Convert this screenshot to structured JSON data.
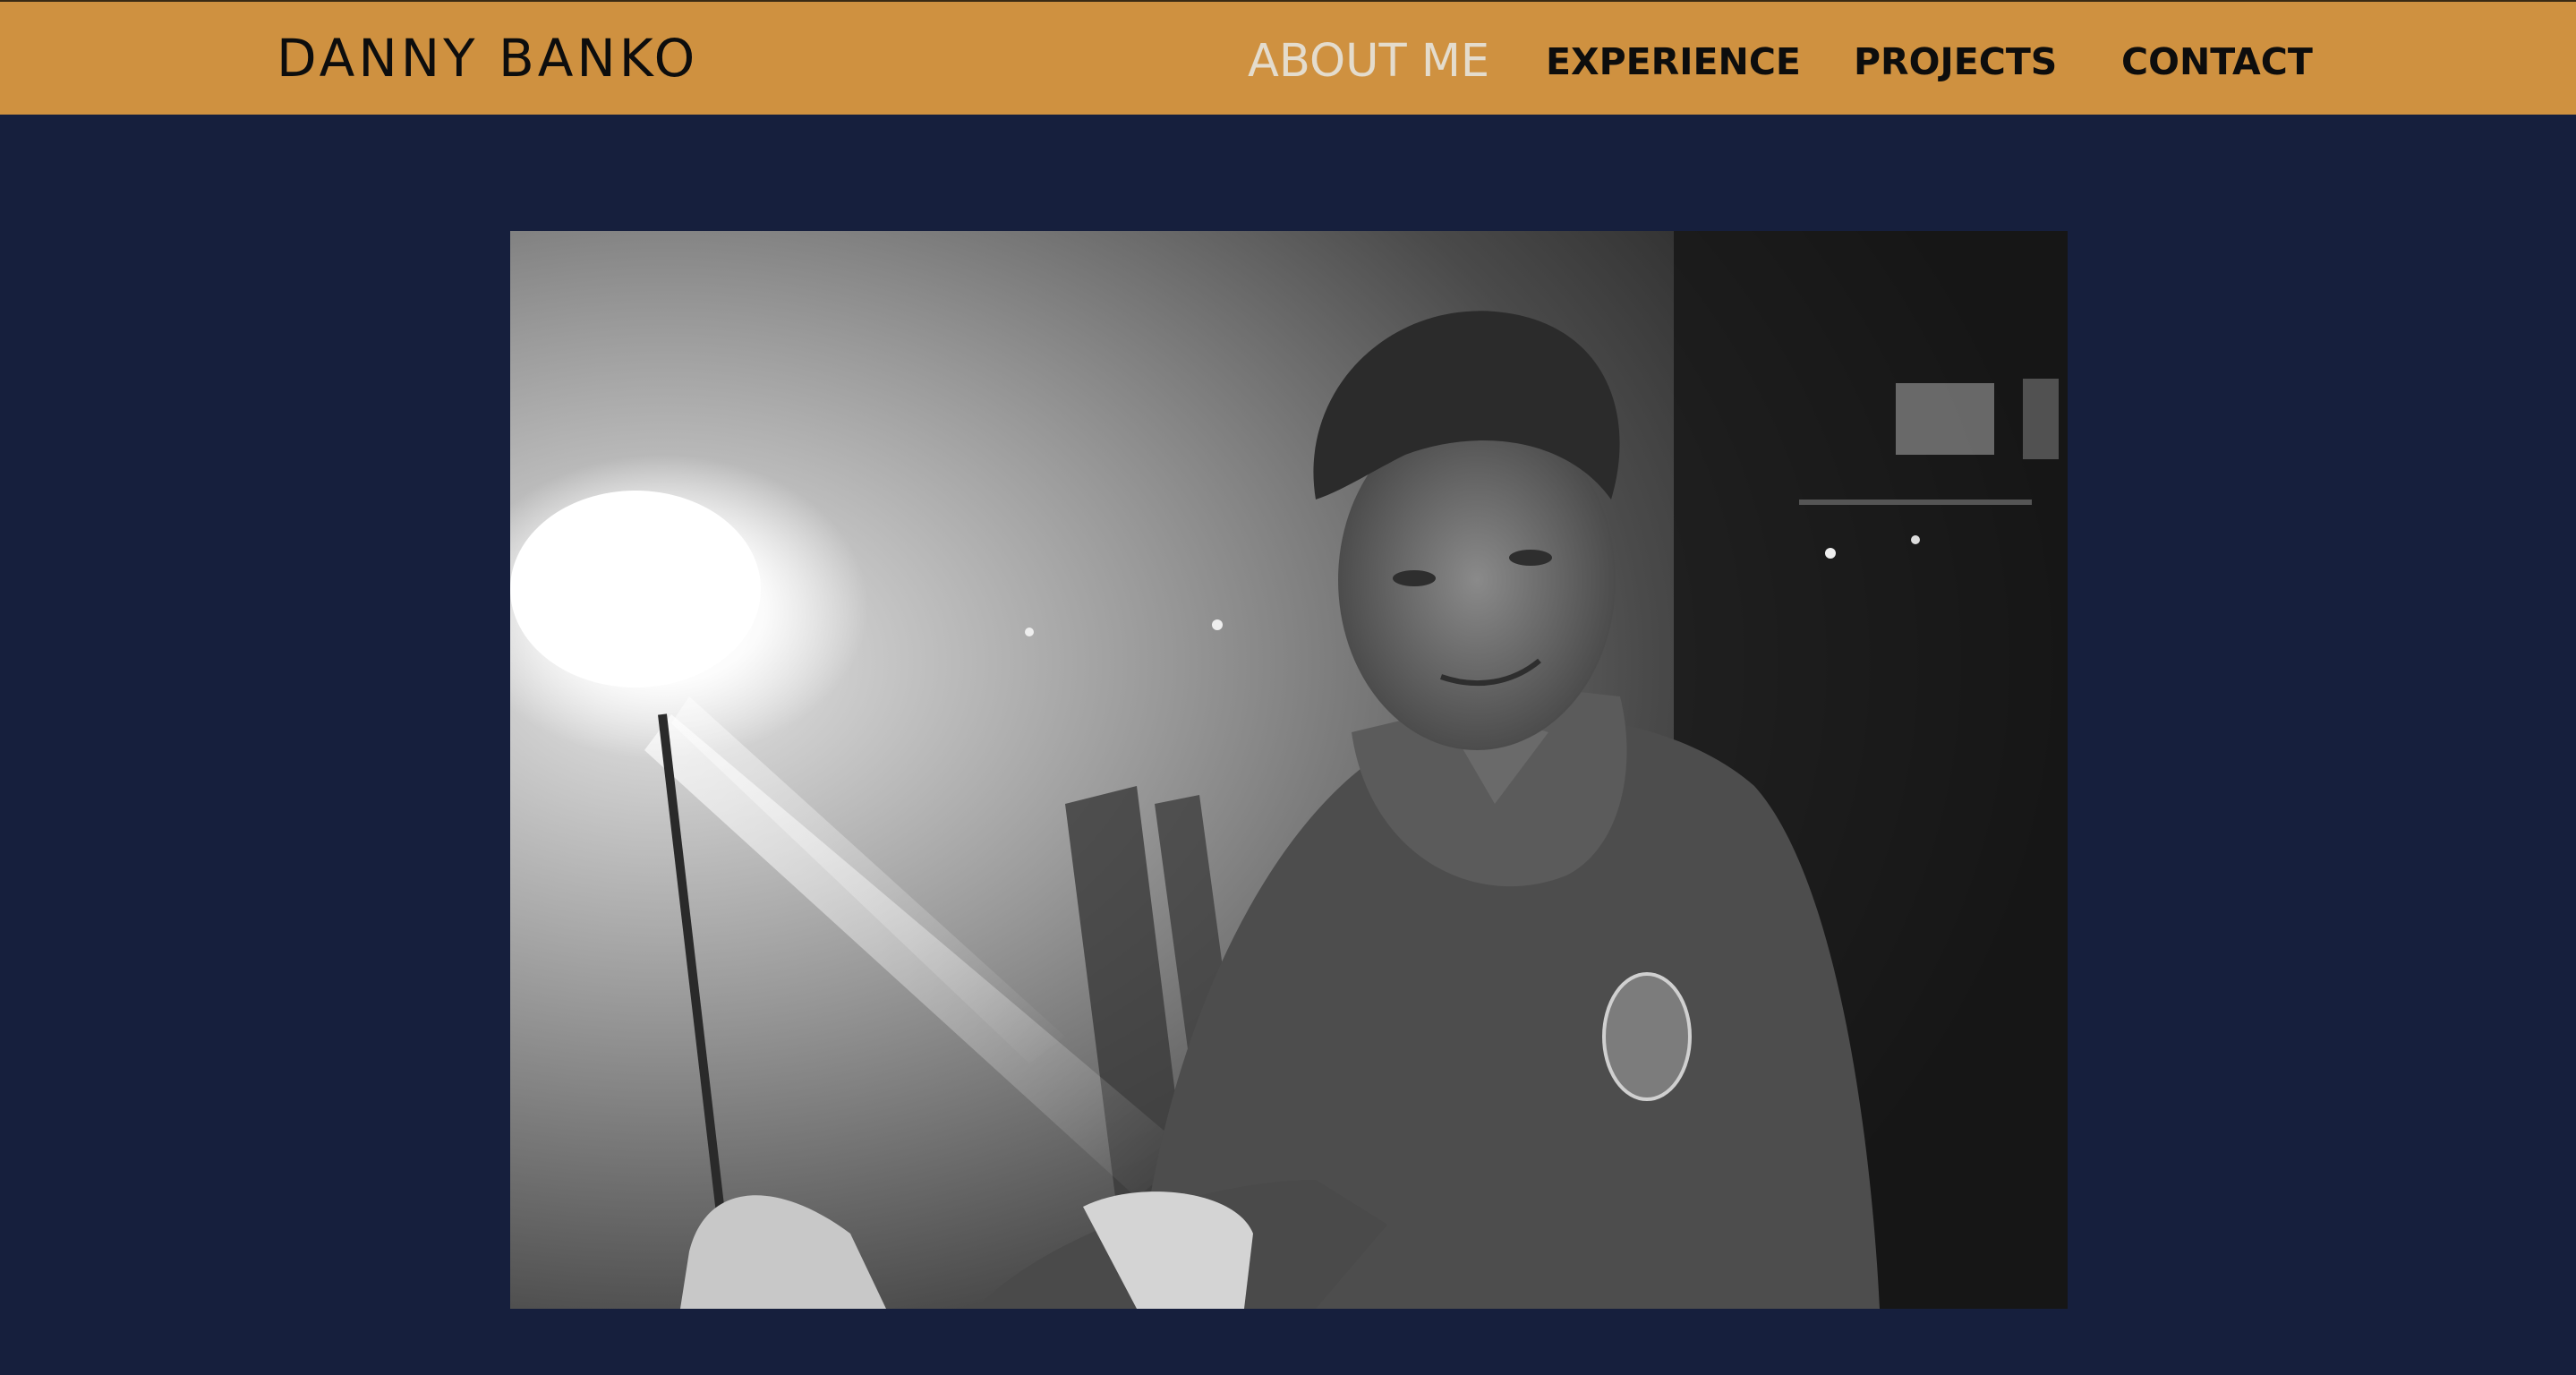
{
  "header": {
    "brand": "DANNY BANKO",
    "nav": [
      {
        "label": "ABOUT ME",
        "active": true
      },
      {
        "label": "EXPERIENCE",
        "active": false
      },
      {
        "label": "PROJECTS",
        "active": false
      },
      {
        "label": "CONTACT",
        "active": false
      }
    ]
  },
  "colors": {
    "navbar_bg": "#cf9140",
    "page_bg": "#161f3d",
    "nav_text": "#0d0d0d",
    "nav_active_text": "#e4dccd"
  },
  "main": {
    "photo_icon": "profile-photo"
  }
}
